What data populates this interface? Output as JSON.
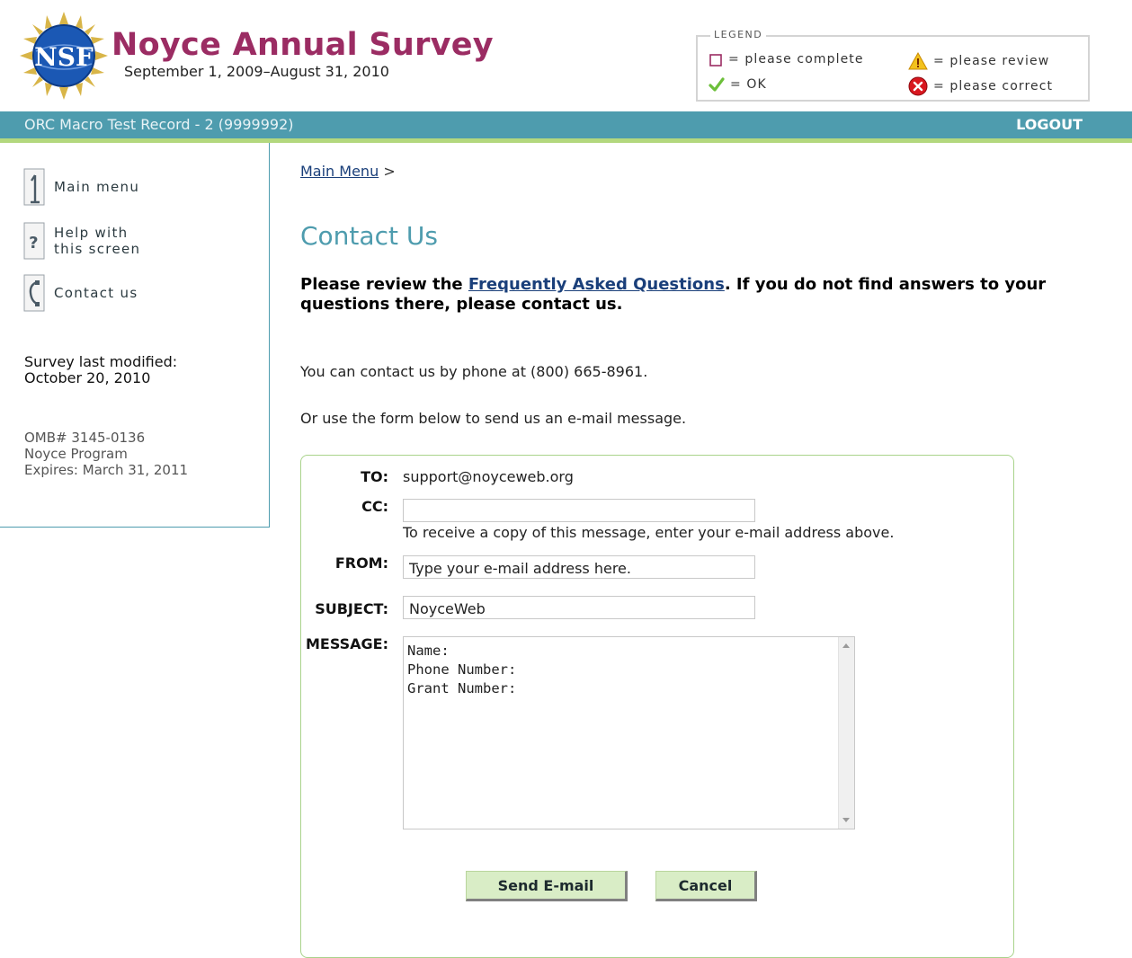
{
  "header": {
    "logo_text": "NSF",
    "title": "Noyce Annual Survey",
    "dates": "September 1, 2009–August 31, 2010"
  },
  "legend": {
    "title": "LEGEND",
    "items": [
      {
        "icon": "empty-square-icon",
        "label": "= please complete"
      },
      {
        "icon": "warning-triangle-icon",
        "label": "= please review"
      },
      {
        "icon": "green-check-icon",
        "label": "= OK"
      },
      {
        "icon": "red-x-circle-icon",
        "label": "= please correct"
      }
    ]
  },
  "userbar": {
    "record": "ORC Macro Test Record - 2 (9999992)",
    "logout": "LOGOUT"
  },
  "sidebar": {
    "links": [
      {
        "icon": "main-menu-icon",
        "label": "Main menu"
      },
      {
        "icon": "help-icon",
        "label_line1": "Help with",
        "label_line2": "this screen"
      },
      {
        "icon": "phone-icon",
        "label": "Contact us"
      }
    ],
    "modified_label": "Survey last modified:",
    "modified_date": "October 20, 2010",
    "omb": "OMB# 3145-0136",
    "program": "Noyce Program",
    "expires": "Expires: March 31, 2011"
  },
  "main": {
    "breadcrumb_link": "Main Menu",
    "breadcrumb_sep": ">",
    "title": "Contact Us",
    "intro_before": "Please review the ",
    "intro_link": "Frequently Asked Questions",
    "intro_after": ". If you do not find answers to your questions there, please contact us.",
    "phone_text": "You can contact us by phone at (800) 665-8961.",
    "form_text": "Or use the form below to send us an e-mail message."
  },
  "form": {
    "to_label": "TO:",
    "to_value": "support@noyceweb.org",
    "cc_label": "CC:",
    "cc_value": "",
    "cc_hint": "To receive a copy of this message, enter your e-mail address above.",
    "from_label": "FROM:",
    "from_value": "Type your e-mail address here.",
    "subject_label": "SUBJECT:",
    "subject_value": "NoyceWeb",
    "message_label": "MESSAGE:",
    "message_value": "Name:\nPhone Number:\nGrant Number:",
    "send_label": "Send E-mail",
    "cancel_label": "Cancel"
  },
  "colors": {
    "brand": "#9b2c63",
    "bar": "#4e9cae",
    "bar_accent": "#b3d87e",
    "button_bg": "#d9edc6"
  }
}
